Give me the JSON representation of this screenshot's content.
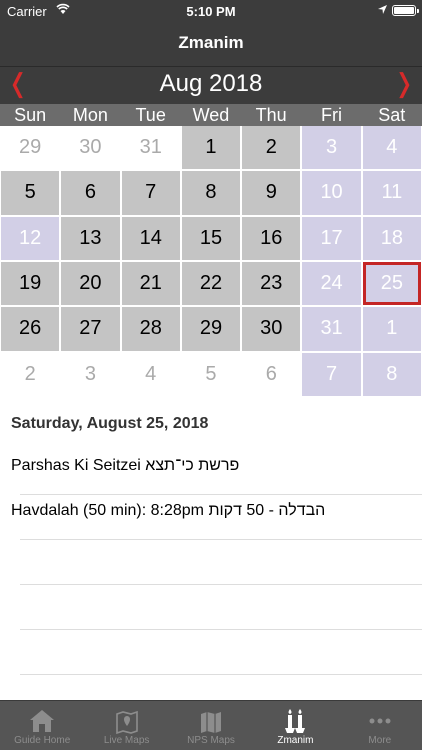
{
  "status_bar": {
    "carrier": "Carrier",
    "time": "5:10 PM"
  },
  "nav": {
    "title": "Zmanim"
  },
  "calendar": {
    "month_label": "Aug 2018",
    "prev_glyph": "❬",
    "next_glyph": "❭",
    "weekdays": [
      "Sun",
      "Mon",
      "Tue",
      "Wed",
      "Thu",
      "Fri",
      "Sat"
    ],
    "days": [
      {
        "label": "29",
        "kind": "out"
      },
      {
        "label": "30",
        "kind": "out"
      },
      {
        "label": "31",
        "kind": "out"
      },
      {
        "label": "1",
        "kind": "wk"
      },
      {
        "label": "2",
        "kind": "wk"
      },
      {
        "label": "3",
        "kind": "sh"
      },
      {
        "label": "4",
        "kind": "sh"
      },
      {
        "label": "5",
        "kind": "wk"
      },
      {
        "label": "6",
        "kind": "wk"
      },
      {
        "label": "7",
        "kind": "wk"
      },
      {
        "label": "8",
        "kind": "wk"
      },
      {
        "label": "9",
        "kind": "wk"
      },
      {
        "label": "10",
        "kind": "sh"
      },
      {
        "label": "11",
        "kind": "sh"
      },
      {
        "label": "12",
        "kind": "sh"
      },
      {
        "label": "13",
        "kind": "wk"
      },
      {
        "label": "14",
        "kind": "wk"
      },
      {
        "label": "15",
        "kind": "wk"
      },
      {
        "label": "16",
        "kind": "wk"
      },
      {
        "label": "17",
        "kind": "sh"
      },
      {
        "label": "18",
        "kind": "sh"
      },
      {
        "label": "19",
        "kind": "wk"
      },
      {
        "label": "20",
        "kind": "wk"
      },
      {
        "label": "21",
        "kind": "wk"
      },
      {
        "label": "22",
        "kind": "wk"
      },
      {
        "label": "23",
        "kind": "wk"
      },
      {
        "label": "24",
        "kind": "sh"
      },
      {
        "label": "25",
        "kind": "sel"
      },
      {
        "label": "26",
        "kind": "wk"
      },
      {
        "label": "27",
        "kind": "wk"
      },
      {
        "label": "28",
        "kind": "wk"
      },
      {
        "label": "29",
        "kind": "wk"
      },
      {
        "label": "30",
        "kind": "wk"
      },
      {
        "label": "31",
        "kind": "sh"
      },
      {
        "label": "1",
        "kind": "sh"
      },
      {
        "label": "2",
        "kind": "out"
      },
      {
        "label": "3",
        "kind": "out"
      },
      {
        "label": "4",
        "kind": "out"
      },
      {
        "label": "5",
        "kind": "out"
      },
      {
        "label": "6",
        "kind": "out"
      },
      {
        "label": "7",
        "kind": "sh"
      },
      {
        "label": "8",
        "kind": "sh"
      }
    ]
  },
  "details": {
    "date": "Saturday, August 25, 2018",
    "parsha": "Parshas Ki Seitzei פרשת כי־תצא",
    "havdalah": "Havdalah (50 min): 8:28pm הבדלה - 50 דקות"
  },
  "tabs": [
    {
      "label": "Guide Home",
      "icon": "home-icon",
      "active": false
    },
    {
      "label": "Live Maps",
      "icon": "map-pin-icon",
      "active": false
    },
    {
      "label": "NPS Maps",
      "icon": "map-icon",
      "active": false
    },
    {
      "label": "Zmanim",
      "icon": "candles-icon",
      "active": true
    },
    {
      "label": "More",
      "icon": "more-icon",
      "active": false
    }
  ],
  "colors": {
    "bar": "#3c3c3c",
    "accent": "#d62a2a",
    "shabbos": "#d2cfe6",
    "weekday": "#c4c4c4"
  }
}
